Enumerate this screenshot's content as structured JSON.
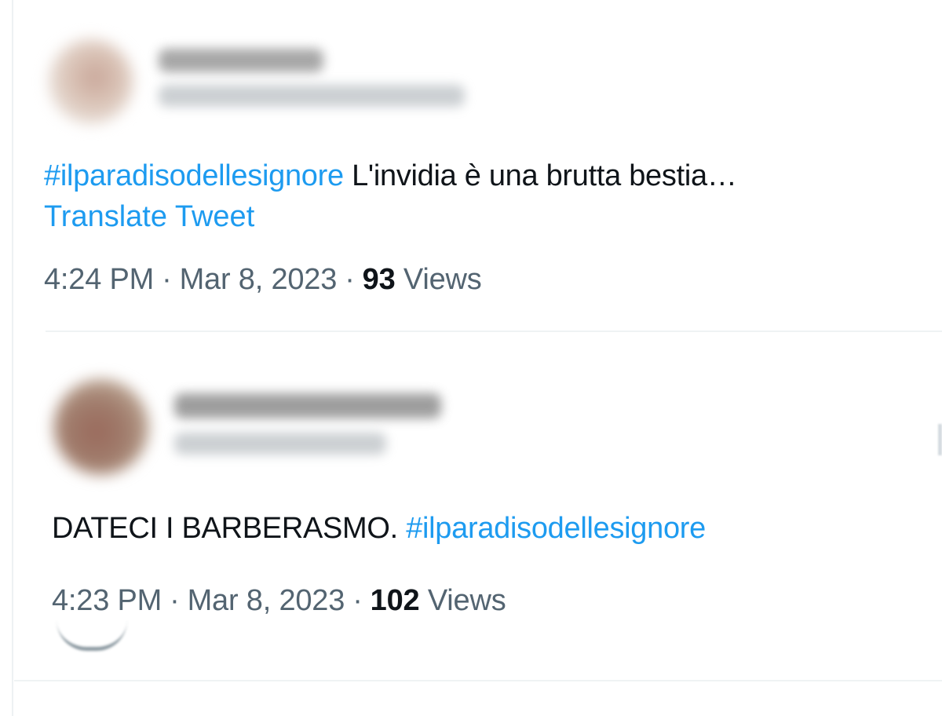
{
  "tweets": [
    {
      "text_hashtag": "#ilparadisodellesignore",
      "text_body": " L'invidia è una brutta bestia…",
      "translate_label": "Translate Tweet",
      "time": "4:24 PM",
      "date": "Mar 8, 2023",
      "separator": "·",
      "views_count": "93",
      "views_label": "Views"
    },
    {
      "text_body": "DATECI I BARBERASMO. ",
      "text_hashtag": "#ilparadisodellesignore",
      "time": "4:23 PM",
      "date": "Mar 8, 2023",
      "separator": "·",
      "views_count": "102",
      "views_label": "Views"
    }
  ],
  "colors": {
    "hashtag": "#1d9bf0",
    "text": "#0f1419",
    "meta": "#536471",
    "divider": "#eff3f4"
  }
}
